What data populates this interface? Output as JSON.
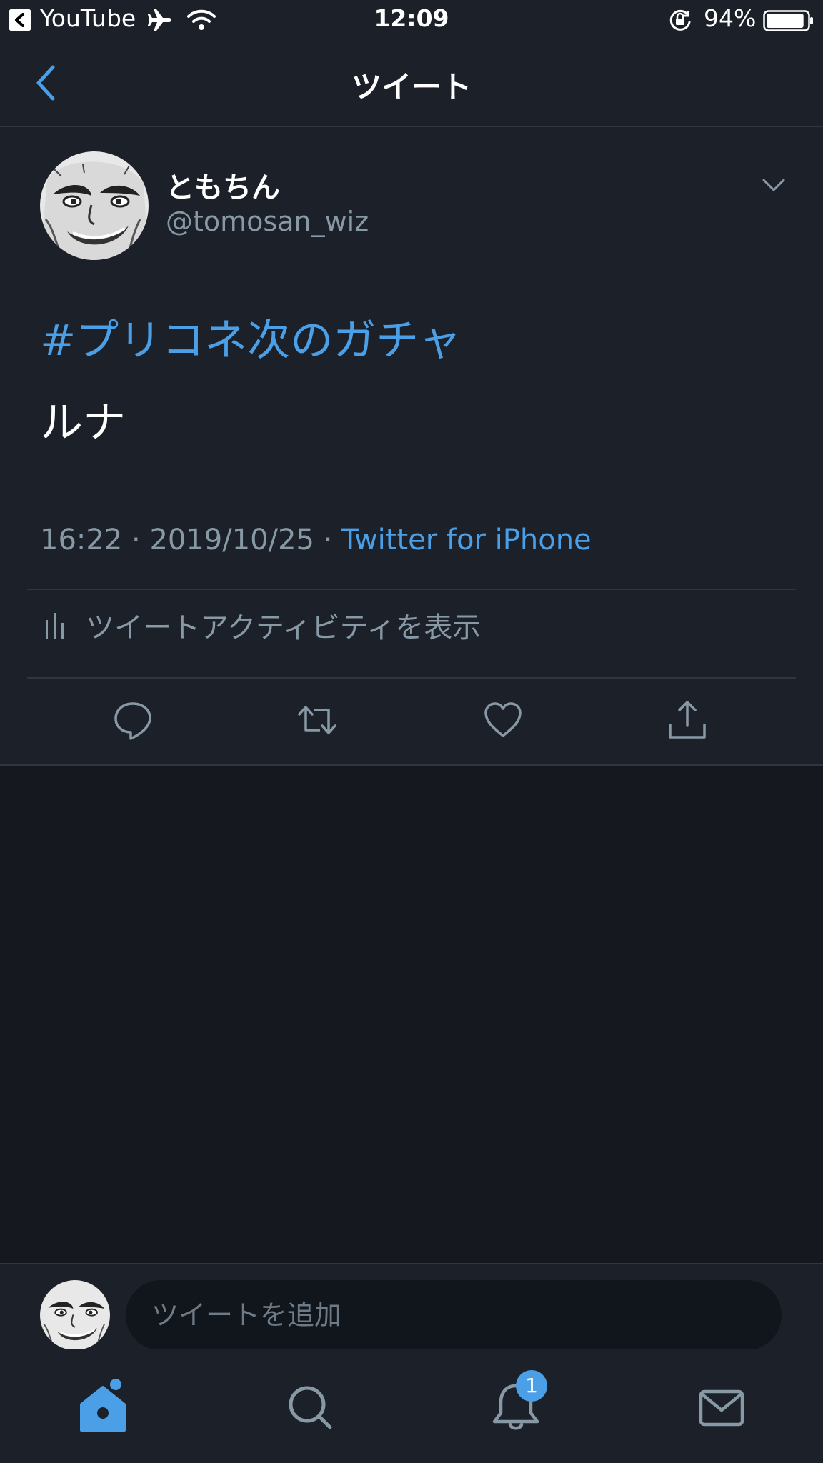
{
  "status_bar": {
    "back_app": "YouTube",
    "time": "12:09",
    "battery_percent": "94%",
    "battery_level": 0.94
  },
  "header": {
    "title": "ツイート"
  },
  "tweet": {
    "display_name": "ともちん",
    "handle": "@tomosan_wiz",
    "hashtag": "#プリコネ次のガチャ",
    "body": "ルナ",
    "time": "16:22",
    "date": "2019/10/25",
    "separator": " · ",
    "source": "Twitter for iPhone",
    "activity_label": "ツイートアクティビティを表示"
  },
  "reply": {
    "placeholder": "ツイートを追加"
  },
  "tabbar": {
    "notification_count": "1"
  },
  "colors": {
    "accent": "#4b9fe7",
    "background": "#1b2029",
    "secondary_text": "#8899a6"
  }
}
